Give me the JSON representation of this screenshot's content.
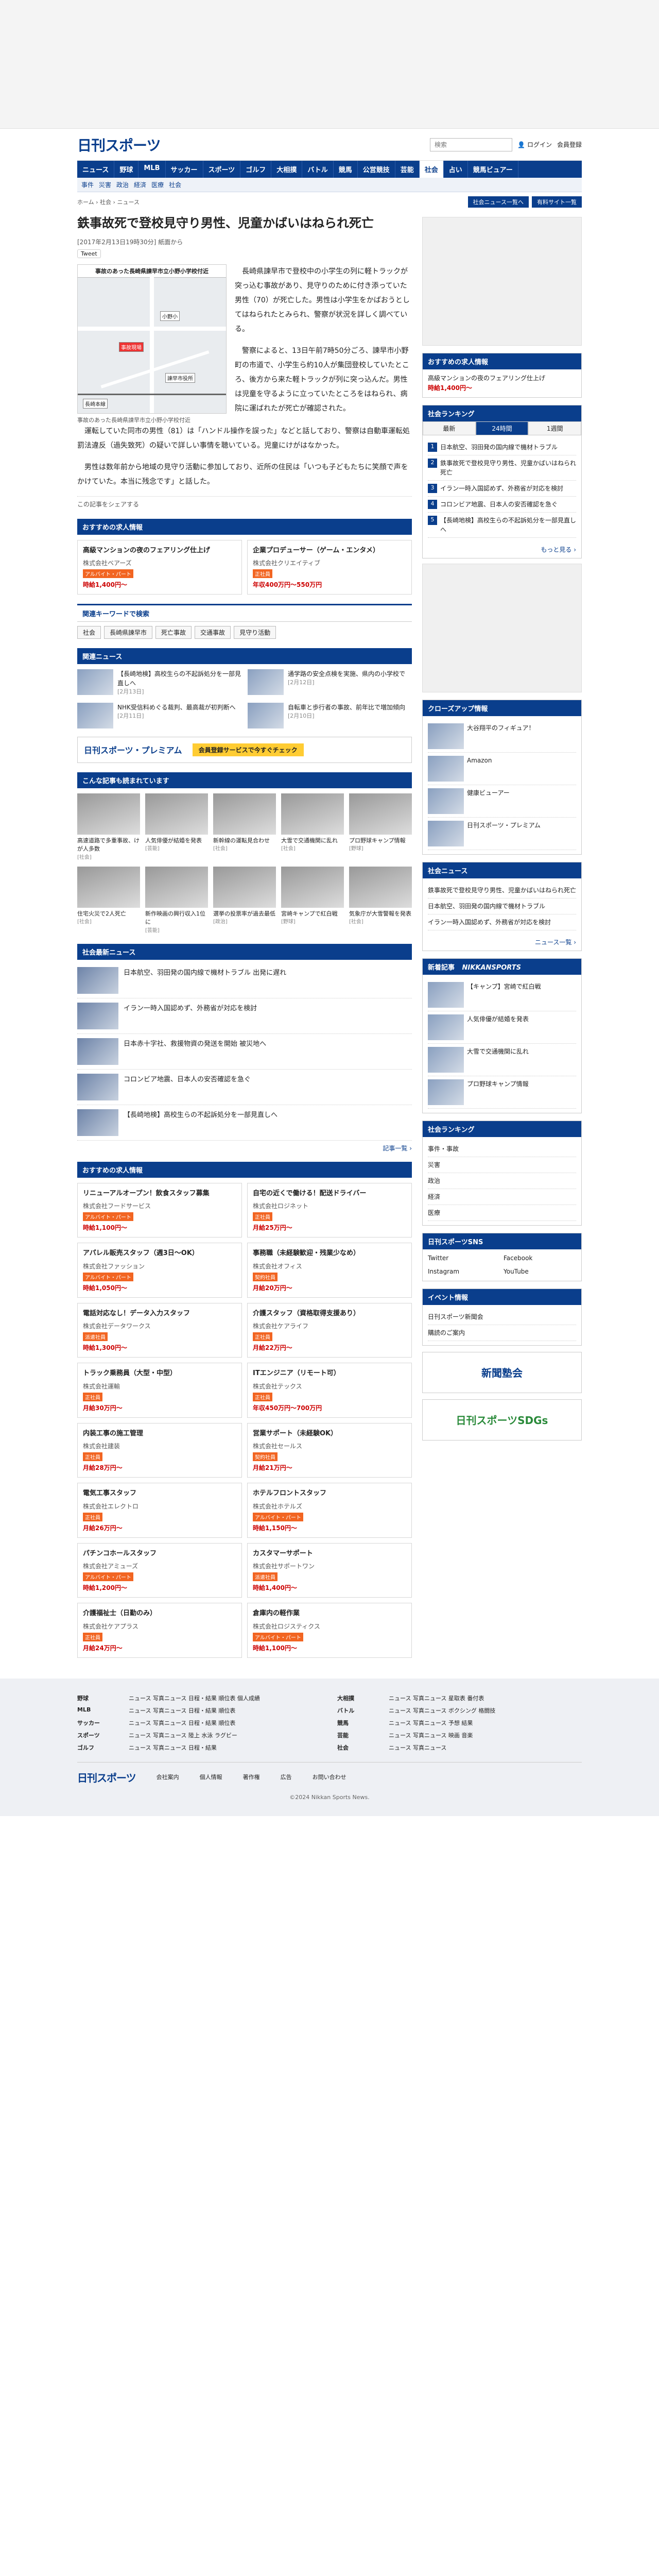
{
  "header": {
    "logo": "日刊スポーツ",
    "search_placeholder": "検索",
    "login_label": "ログイン",
    "members_label": "会員登録"
  },
  "nav": [
    "ニュース",
    "野球",
    "MLB",
    "サッカー",
    "スポーツ",
    "ゴルフ",
    "大相撲",
    "バトル",
    "競馬",
    "公営競技",
    "芸能",
    "社会",
    "占い",
    "競馬ビュアー"
  ],
  "subnav": [
    "事件",
    "災害",
    "政治",
    "経済",
    "医療",
    "社会"
  ],
  "breadcrumb": "ホーム › 社会 › ニュース",
  "crumb_buttons": [
    "社会ニュース一覧へ",
    "有料サイト一覧"
  ],
  "article": {
    "title": "鉄事故死で登校見守り男性、児童かばいはねられ死亡",
    "date": "[2017年2月13日19時30分]",
    "updated": "紙面から",
    "tweet": "Tweet",
    "map_title": "事故のあった長崎県諫早市立小野小学校付近",
    "map_labels": [
      "小野小",
      "事故現場",
      "諫早市役所",
      "長崎本線"
    ],
    "caption": "事故のあった長崎県諫早市立小野小学校付近",
    "paragraphs": [
      "長崎県諫早市で登校中の小学生の列に軽トラックが突っ込む事故があり、見守りのために付き添っていた男性（70）が死亡した。男性は小学生をかばおうとしてはねられたとみられ、警察が状況を詳しく調べている。",
      "警察によると、13日午前7時50分ごろ、諫早市小野町の市道で、小学生ら約10人が集団登校していたところ、後方から来た軽トラックが列に突っ込んだ。男性は児童を守るように立っていたところをはねられ、病院に運ばれたが死亡が確認された。",
      "運転していた同市の男性（81）は「ハンドル操作を誤った」などと話しており、警察は自動車運転処罰法違反（過失致死）の疑いで詳しい事情を聴いている。児童にけがはなかった。",
      "男性は数年前から地域の見守り活動に参加しており、近所の住民は「いつも子どもたちに笑顔で声をかけていた。本当に残念です」と話した。"
    ],
    "share_label": "この記事をシェアする"
  },
  "jobs_top": [
    {
      "title": "高級マンションの夜のフェアリング仕上げ",
      "company": "株式会社ベアーズ",
      "tag": "アルバイト・パート",
      "pay": "時給1,400円〜"
    },
    {
      "title": "企業プロデューサー（ゲーム・エンタメ）",
      "company": "株式会社クリエイティブ",
      "tag": "正社員",
      "pay": "年収400万円〜550万円"
    }
  ],
  "keywords_head": "関連キーワードで検索",
  "keywords": [
    "社会",
    "長崎県諫早市",
    "死亡事故",
    "交通事故",
    "見守り活動"
  ],
  "related_head": "関連ニュース",
  "related": [
    {
      "text": "【長崎地検】高校生らの不起訴処分を一部見直しへ",
      "date": "[2月13日]"
    },
    {
      "text": "通学路の安全点検を実施、県内の小学校で",
      "date": "[2月12日]"
    },
    {
      "text": "NHK受信料めぐる裁判、最高裁が初判断へ",
      "date": "[2月11日]"
    },
    {
      "text": "自転車と歩行者の事故、前年比で増加傾向",
      "date": "[2月10日]"
    }
  ],
  "premium": {
    "logo": "日刊スポーツ・プレミアム",
    "button": "会員登録サービスで今すぐチェック"
  },
  "tiles_head": "こんな記事も読まれています",
  "tiles": [
    {
      "text": "高速道路で多重事故、けが人多数",
      "src": "[社会]"
    },
    {
      "text": "人気俳優が結婚を発表",
      "src": "[芸能]"
    },
    {
      "text": "新幹線の運転見合わせ",
      "src": "[社会]"
    },
    {
      "text": "大雪で交通機関に乱れ",
      "src": "[社会]"
    },
    {
      "text": "プロ野球キャンプ情報",
      "src": "[野球]"
    },
    {
      "text": "住宅火災で2人死亡",
      "src": "[社会]"
    },
    {
      "text": "新作映画の興行収入1位に",
      "src": "[芸能]"
    },
    {
      "text": "選挙の投票率が過去最低",
      "src": "[政治]"
    },
    {
      "text": "宮崎キャンプで紅白戦",
      "src": "[野球]"
    },
    {
      "text": "気象庁が大雪警報を発表",
      "src": "[社会]"
    }
  ],
  "social_head": "社会最新ニュース",
  "social_news": [
    "日本航空、羽田発の国内線で機材トラブル 出発に遅れ",
    "イラン一時入国認めず、外務省が対応を検討",
    "日本赤十字社、救援物資の発送を開始 被災地へ",
    "コロンビア地震、日本人の安否確認を急ぐ",
    "【長崎地検】高校生らの不起訴処分を一部見直しへ"
  ],
  "more_label": "記事一覧 ›",
  "jobs_bottom": [
    {
      "title": "リニューアルオープン！飲食スタッフ募集",
      "company": "株式会社フードサービス",
      "tag": "アルバイト・パート",
      "pay": "時給1,100円〜"
    },
    {
      "title": "自宅の近くで働ける！配送ドライバー",
      "company": "株式会社ロジネット",
      "tag": "正社員",
      "pay": "月給25万円〜"
    },
    {
      "title": "アパレル販売スタッフ（週3日〜OK）",
      "company": "株式会社ファッション",
      "tag": "アルバイト・パート",
      "pay": "時給1,050円〜"
    },
    {
      "title": "事務職（未経験歓迎・残業少なめ）",
      "company": "株式会社オフィス",
      "tag": "契約社員",
      "pay": "月給20万円〜"
    },
    {
      "title": "電話対応なし！データ入力スタッフ",
      "company": "株式会社データワークス",
      "tag": "派遣社員",
      "pay": "時給1,300円〜"
    },
    {
      "title": "介護スタッフ（資格取得支援あり）",
      "company": "株式会社ケアライフ",
      "tag": "正社員",
      "pay": "月給22万円〜"
    },
    {
      "title": "トラック乗務員（大型・中型）",
      "company": "株式会社運輸",
      "tag": "正社員",
      "pay": "月給30万円〜"
    },
    {
      "title": "ITエンジニア（リモート可）",
      "company": "株式会社テックス",
      "tag": "正社員",
      "pay": "年収450万円〜700万円"
    },
    {
      "title": "内装工事の施工管理",
      "company": "株式会社建装",
      "tag": "正社員",
      "pay": "月給28万円〜"
    },
    {
      "title": "営業サポート（未経験OK）",
      "company": "株式会社セールス",
      "tag": "契約社員",
      "pay": "月給21万円〜"
    },
    {
      "title": "電気工事スタッフ",
      "company": "株式会社エレクトロ",
      "tag": "正社員",
      "pay": "月給26万円〜"
    },
    {
      "title": "ホテルフロントスタッフ",
      "company": "株式会社ホテルズ",
      "tag": "アルバイト・パート",
      "pay": "時給1,150円〜"
    },
    {
      "title": "パチンコホールスタッフ",
      "company": "株式会社アミューズ",
      "tag": "アルバイト・パート",
      "pay": "時給1,200円〜"
    },
    {
      "title": "カスタマーサポート",
      "company": "株式会社サポートワン",
      "tag": "派遣社員",
      "pay": "時給1,400円〜"
    },
    {
      "title": "介護福祉士（日勤のみ）",
      "company": "株式会社ケアプラス",
      "tag": "正社員",
      "pay": "月給24万円〜"
    },
    {
      "title": "倉庫内の軽作業",
      "company": "株式会社ロジスティクス",
      "tag": "アルバイト・パート",
      "pay": "時給1,100円〜"
    }
  ],
  "side": {
    "jobs_head": "おすすめの求人情報",
    "ranking_head": "社会ランキング",
    "ranking_tabs": [
      "最新",
      "24時間",
      "1週間"
    ],
    "ranking": [
      "日本航空、羽田発の国内線で機材トラブル",
      "鉄事故死で登校見守り男性、児童かばいはねられ死亡",
      "イラン一時入国認めず、外務省が対応を検討",
      "コロンビア地震、日本人の安否確認を急ぐ",
      "【長崎地検】高校生らの不起訴処分を一部見直しへ"
    ],
    "ranking_more": "もっと見る ›",
    "closeup_head": "クローズアップ情報",
    "closeup": [
      "大谷翔平のフィギュア！",
      "Amazon",
      "健康ビューアー",
      "日刊スポーツ・プレミアム"
    ],
    "society_head": "社会ニュース",
    "society": [
      "鉄事故死で登校見守り男性、児童かばいはねられ死亡",
      "日本航空、羽田発の国内線で機材トラブル",
      "イラン一時入国認めず、外務省が対応を検討"
    ],
    "society_more": "ニュース一覧 ›",
    "new_head": "新着記事",
    "new_source": "NIKKANSPORTS",
    "new_items": [
      "【キャンプ】宮崎で紅白戦",
      "人気俳優が結婚を発表",
      "大雪で交通機関に乱れ",
      "プロ野球キャンプ情報"
    ],
    "society_links_head": "社会ランキング",
    "society_links": [
      "事件・事故",
      "災害",
      "政治",
      "経済",
      "医療"
    ],
    "sns_head": "日刊スポーツSNS",
    "sns": [
      "Twitter",
      "Facebook",
      "Instagram",
      "YouTube"
    ],
    "event_head": "イベント情報",
    "event": [
      "日刊スポーツ新聞会",
      "購読のご案内"
    ],
    "promo1": "新聞塾会",
    "promo2": "日刊スポーツSDGs"
  },
  "footer": {
    "rows": [
      {
        "h": "野球",
        "t": "ニュース 写真ニュース 日程・結果 順位表 個人成績"
      },
      {
        "h": "大相撲",
        "t": "ニュース 写真ニュース 星取表 番付表"
      },
      {
        "h": "MLB",
        "t": "ニュース 写真ニュース 日程・結果 順位表"
      },
      {
        "h": "バトル",
        "t": "ニュース 写真ニュース ボクシング 格闘技"
      },
      {
        "h": "サッカー",
        "t": "ニュース 写真ニュース 日程・結果 順位表"
      },
      {
        "h": "競馬",
        "t": "ニュース 写真ニュース 予想 結果"
      },
      {
        "h": "スポーツ",
        "t": "ニュース 写真ニュース 陸上 水泳 ラグビー"
      },
      {
        "h": "芸能",
        "t": "ニュース 写真ニュース 映画 音楽"
      },
      {
        "h": "ゴルフ",
        "t": "ニュース 写真ニュース 日程・結果"
      },
      {
        "h": "社会",
        "t": "ニュース 写真ニュース"
      }
    ],
    "bottom_logo": "日刊スポーツ",
    "bottom_links": [
      "会社案内",
      "個人情報",
      "著作権",
      "広告",
      "お問い合わせ"
    ],
    "copyright": "©2024 Nikkan Sports News."
  }
}
